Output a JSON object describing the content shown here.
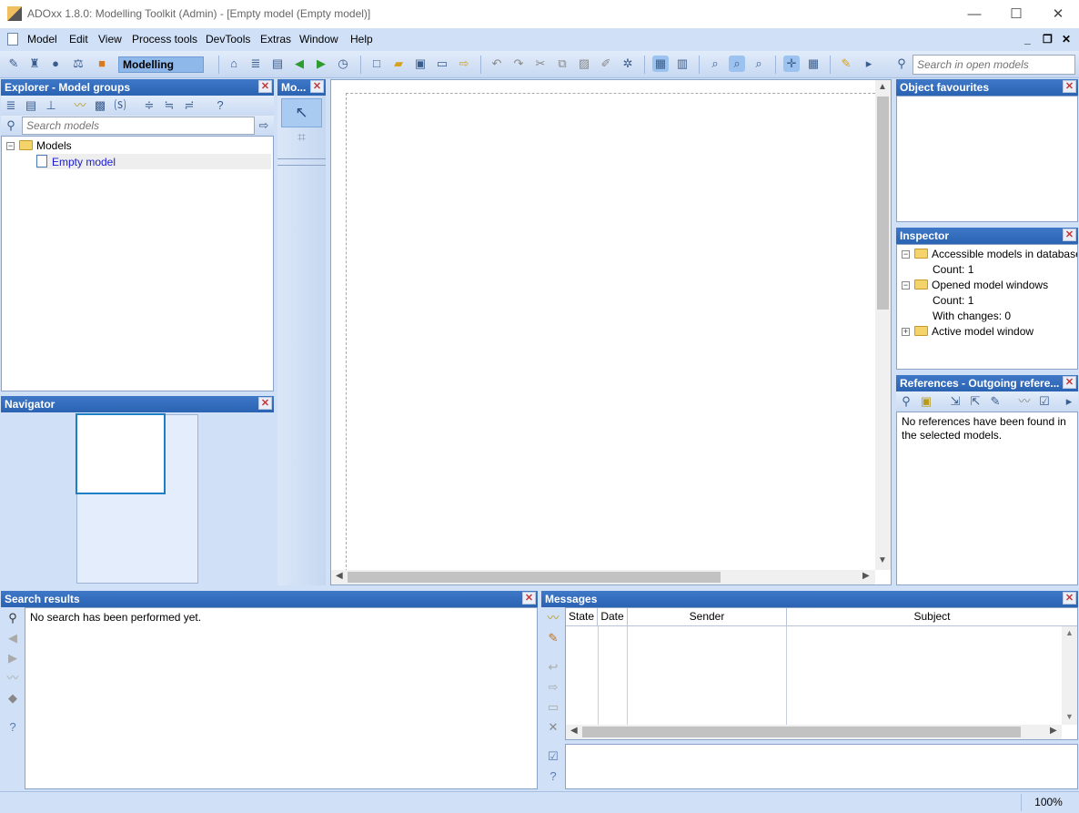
{
  "window": {
    "title": "ADOxx 1.8.0: Modelling Toolkit (Admin) - [Empty model (Empty model)]",
    "minimize": "—",
    "maximize": "☐",
    "close": "✕"
  },
  "menu": {
    "items": [
      "Model",
      "Edit",
      "View",
      "Process tools",
      "DevTools",
      "Extras",
      "Window",
      "Help"
    ],
    "mdi_min": "_",
    "mdi_restore": "❐",
    "mdi_close": "✕"
  },
  "toolbar": {
    "mode_label": "Modelling",
    "search_placeholder": "Search in open models"
  },
  "explorer": {
    "title": "Explorer - Model groups",
    "search_placeholder": "Search models",
    "tree_root": "Models",
    "tree_child": "Empty model"
  },
  "modelling_bar": {
    "title": "Mo..."
  },
  "navigator": {
    "title": "Navigator"
  },
  "favourites": {
    "title": "Object favourites"
  },
  "inspector": {
    "title": "Inspector",
    "items": [
      {
        "label": "Accessible models in database"
      },
      {
        "label": "Count: 1"
      },
      {
        "label": "Opened model windows"
      },
      {
        "label": "Count: 1"
      },
      {
        "label": "With changes: 0"
      },
      {
        "label": "Active model window"
      }
    ]
  },
  "references": {
    "title": "References - Outgoing refere...",
    "message": "No references have been found in the selected models."
  },
  "search_results": {
    "title": "Search results",
    "message": "No search has been performed yet."
  },
  "messages": {
    "title": "Messages",
    "columns": [
      "State",
      "Date",
      "Sender",
      "Subject"
    ]
  },
  "status": {
    "zoom": "100%"
  },
  "colors": {
    "panel_header": "#2c63b3",
    "background": "#cfe0f7",
    "selected_text": "#1a1ad0"
  }
}
